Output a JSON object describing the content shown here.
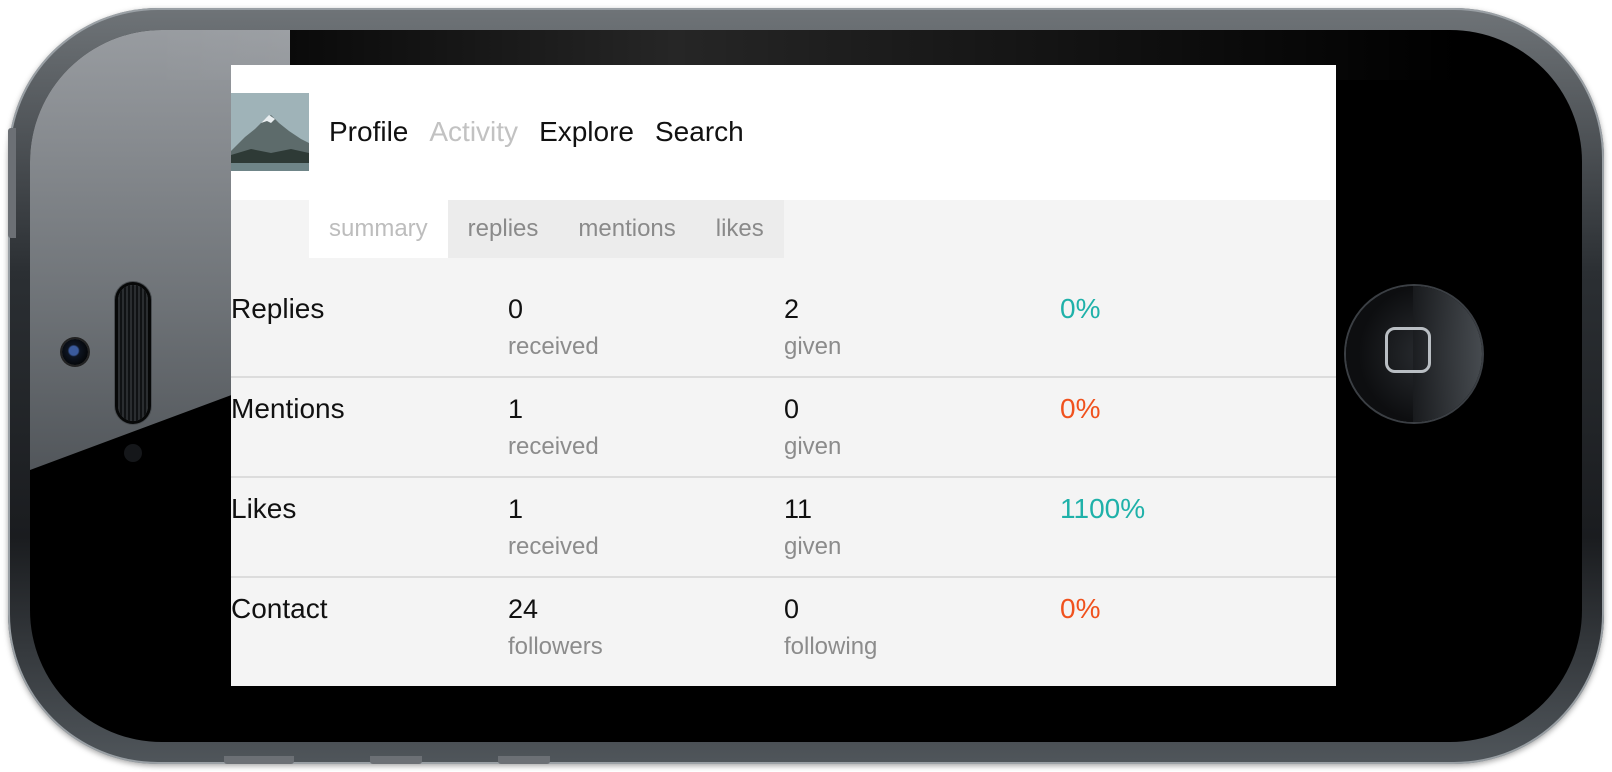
{
  "header": {
    "nav": [
      "Profile",
      "Activity",
      "Explore",
      "Search"
    ],
    "active_nav": "Activity"
  },
  "tabs": {
    "items": [
      "summary",
      "replies",
      "mentions",
      "likes"
    ],
    "active": "summary"
  },
  "stats": [
    {
      "label": "Replies",
      "a_value": "0",
      "a_label": "received",
      "b_value": "2",
      "b_label": "given",
      "percent": "0%",
      "trend": "up"
    },
    {
      "label": "Mentions",
      "a_value": "1",
      "a_label": "received",
      "b_value": "0",
      "b_label": "given",
      "percent": "0%",
      "trend": "down"
    },
    {
      "label": "Likes",
      "a_value": "1",
      "a_label": "received",
      "b_value": "11",
      "b_label": "given",
      "percent": "1100%",
      "trend": "up"
    },
    {
      "label": "Contact",
      "a_value": "24",
      "a_label": "followers",
      "b_value": "0",
      "b_label": "following",
      "percent": "0%",
      "trend": "down"
    }
  ],
  "colors": {
    "percent_up": "#1fb1a9",
    "percent_down": "#f0521e",
    "nav_active": "#c2c2c2"
  },
  "icons": {
    "avatar": "mountain-photo",
    "home_button": "home-button-icon"
  }
}
